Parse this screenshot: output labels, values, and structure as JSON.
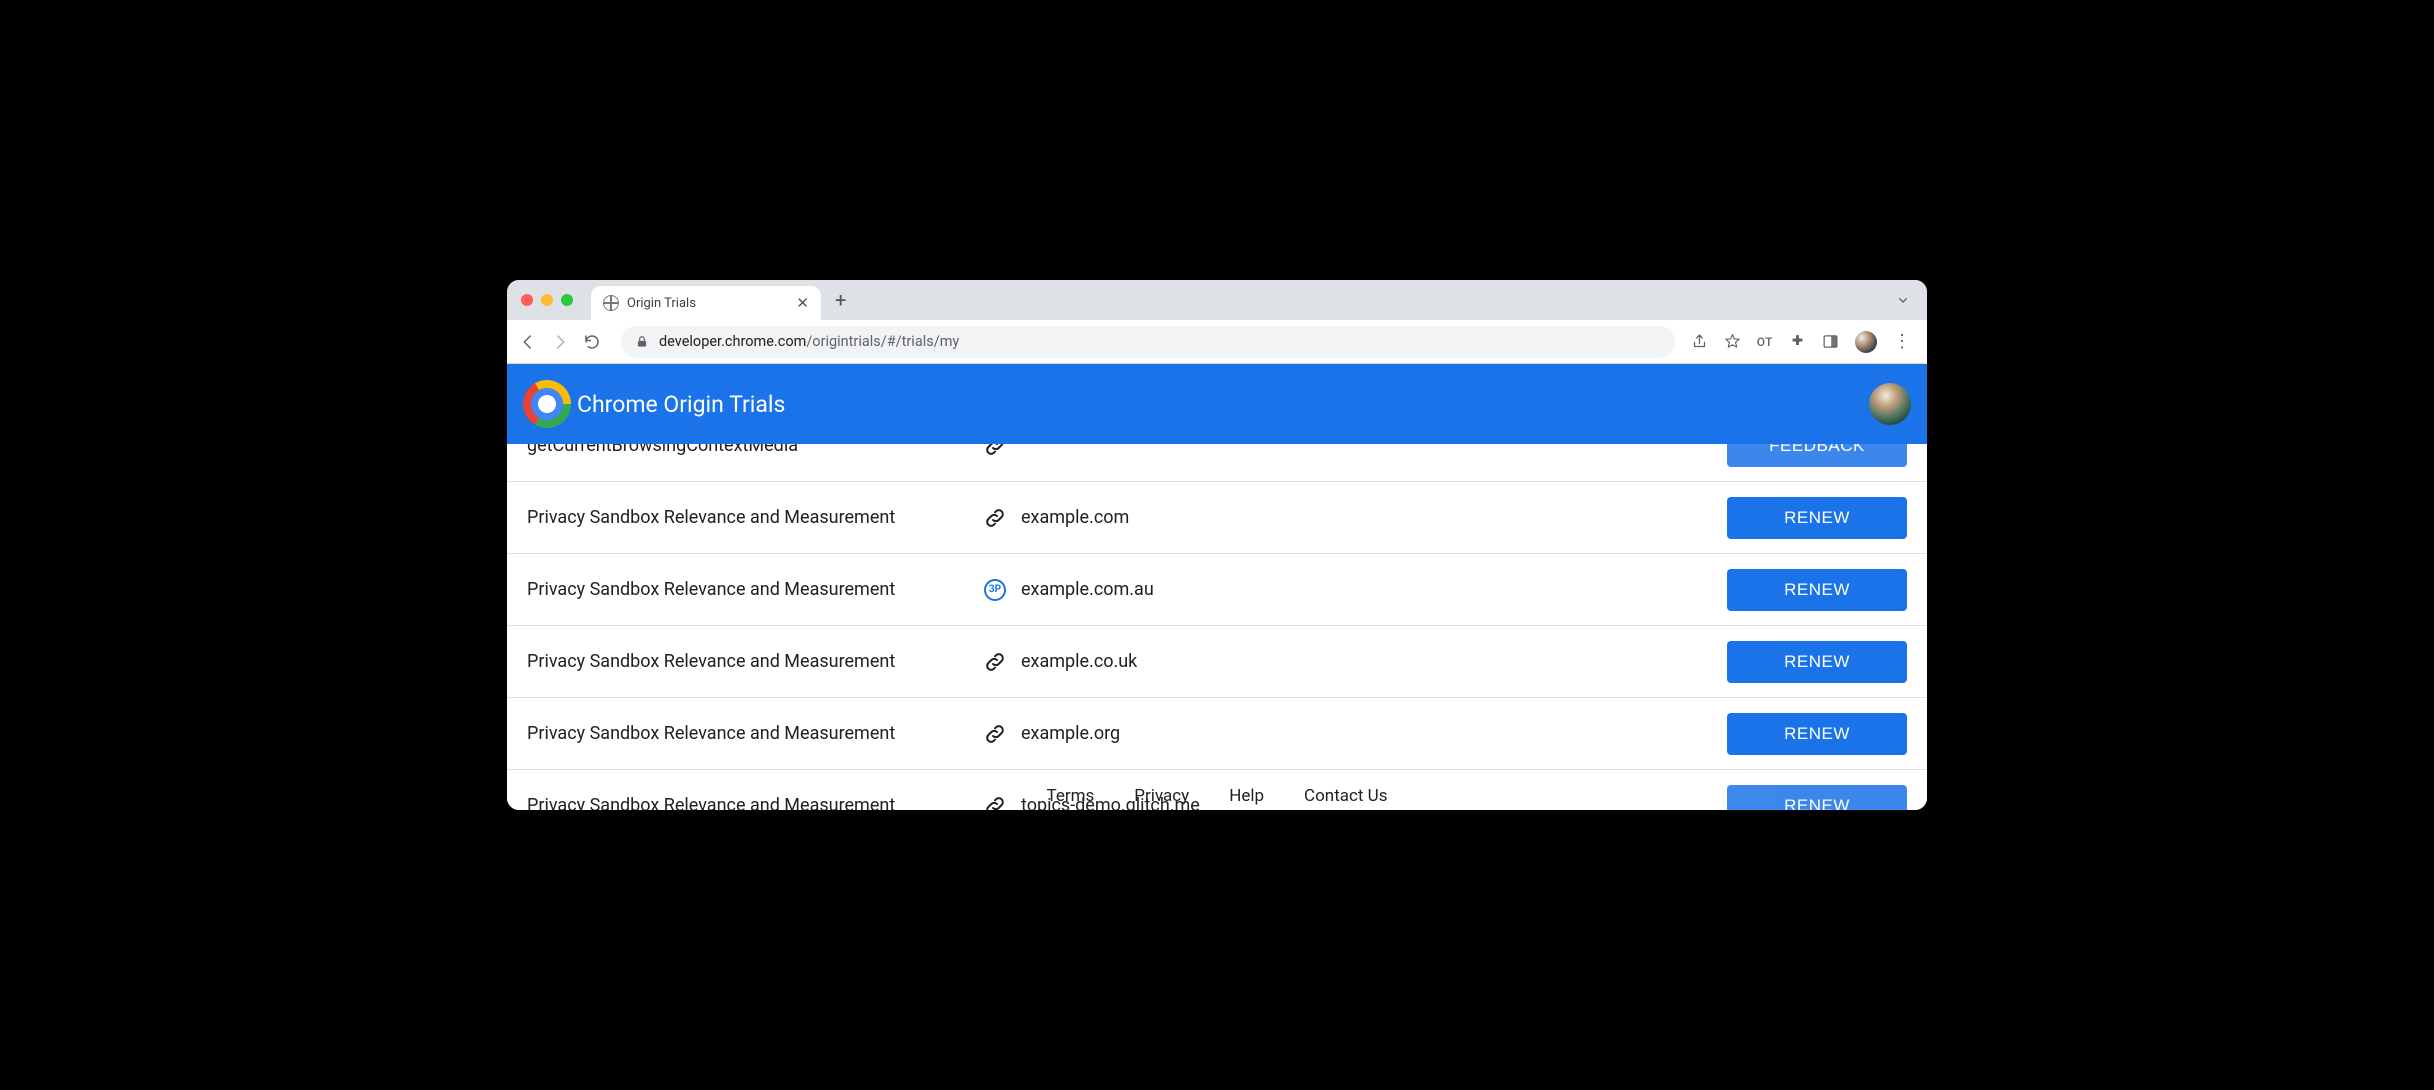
{
  "browser": {
    "tab_title": "Origin Trials",
    "url_host": "developer.chrome.com",
    "url_path": "/origintrials/#/trials/my",
    "toolbar_badge": "OT"
  },
  "app": {
    "title": "Chrome Origin Trials"
  },
  "rows": [
    {
      "name": "getCurrentBrowsingContextMedia",
      "icon": "link",
      "domain": "",
      "action": "FEEDBACK"
    },
    {
      "name": "Privacy Sandbox Relevance and Measurement",
      "icon": "link",
      "domain": "example.com",
      "action": "RENEW"
    },
    {
      "name": "Privacy Sandbox Relevance and Measurement",
      "icon": "3p",
      "domain": "example.com.au",
      "action": "RENEW"
    },
    {
      "name": "Privacy Sandbox Relevance and Measurement",
      "icon": "link",
      "domain": "example.co.uk",
      "action": "RENEW"
    },
    {
      "name": "Privacy Sandbox Relevance and Measurement",
      "icon": "link",
      "domain": "example.org",
      "action": "RENEW"
    },
    {
      "name": "Privacy Sandbox Relevance and Measurement",
      "icon": "link",
      "domain": "topics-demo.glitch.me",
      "action": "RENEW"
    }
  ],
  "threep_label": "3P",
  "footer": {
    "terms": "Terms",
    "privacy": "Privacy",
    "help": "Help",
    "contact": "Contact Us"
  }
}
